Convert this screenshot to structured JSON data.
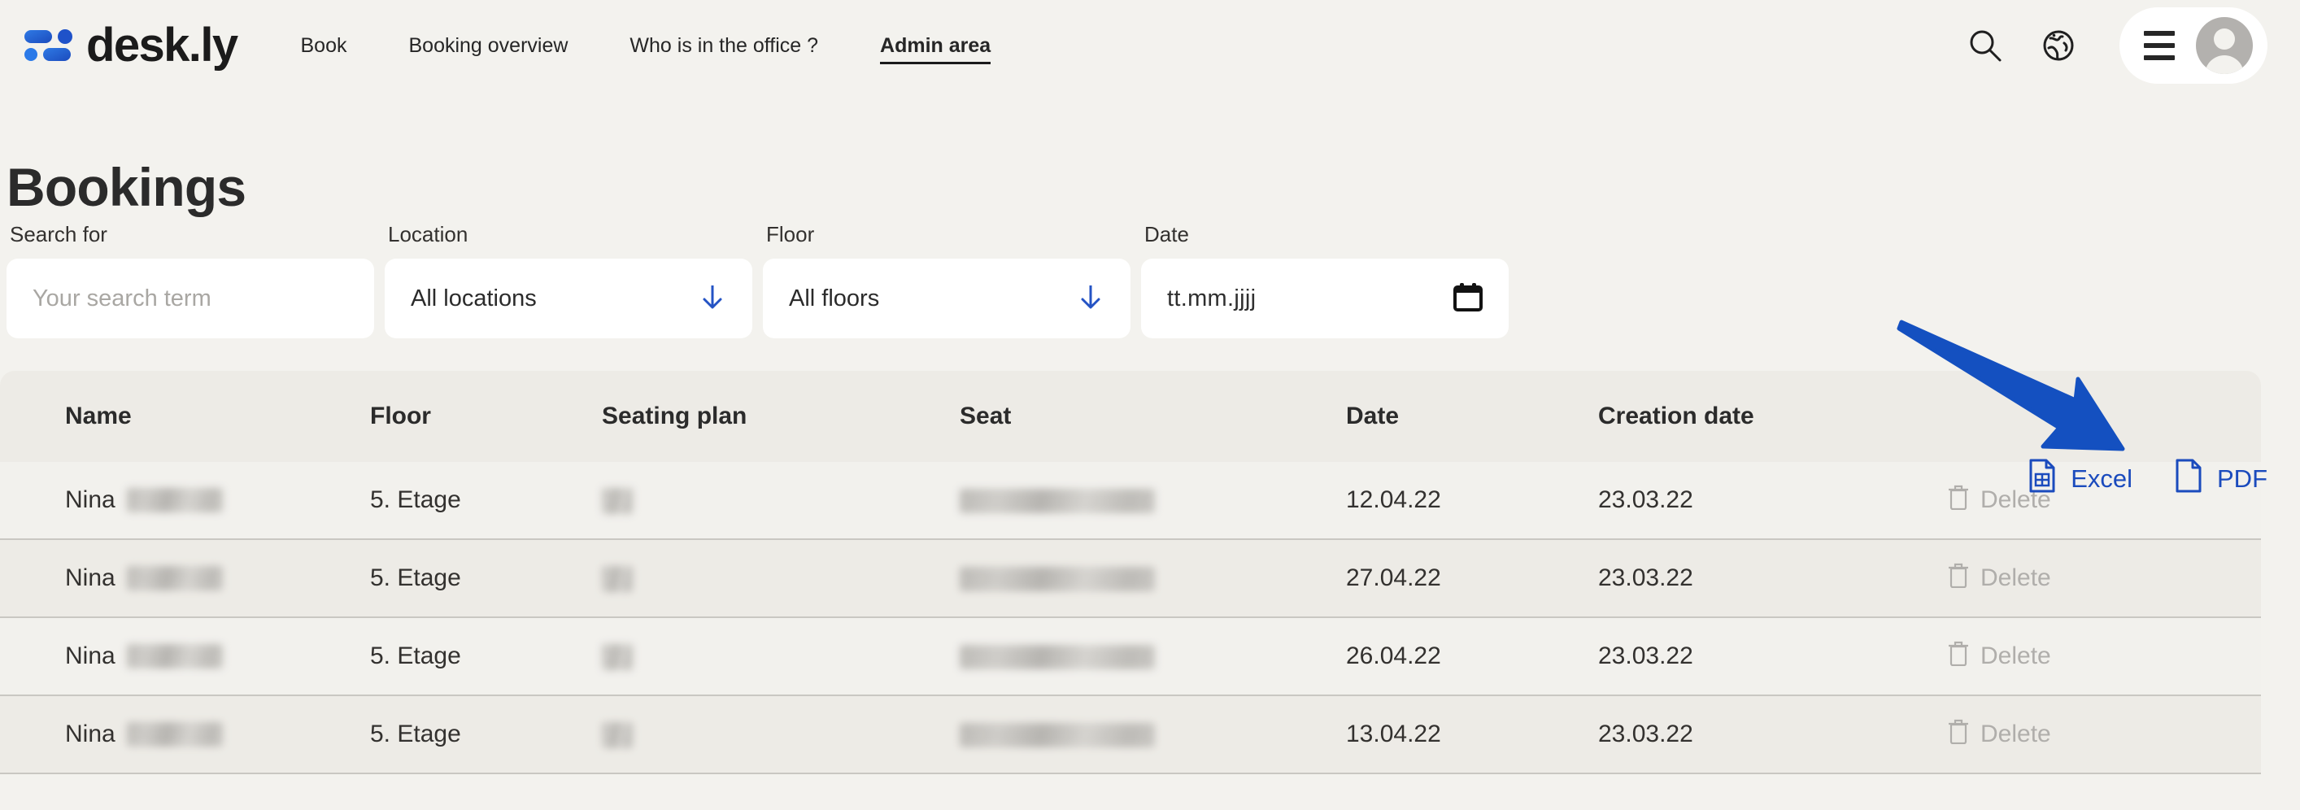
{
  "brand": {
    "name": "desk.ly",
    "logo_icon": "deskly-logo-icon"
  },
  "nav": {
    "items": [
      {
        "label": "Book",
        "active": false
      },
      {
        "label": "Booking overview",
        "active": false
      },
      {
        "label": "Who is in the office ?",
        "active": false
      },
      {
        "label": "Admin area",
        "active": true
      }
    ]
  },
  "header_icons": {
    "search": "search-icon",
    "language": "globe-icon",
    "menu": "hamburger-icon",
    "avatar": "user-avatar-icon"
  },
  "page": {
    "title": "Bookings"
  },
  "filters": {
    "search": {
      "label": "Search for",
      "placeholder": "Your search term",
      "value": ""
    },
    "location": {
      "label": "Location",
      "value": "All locations",
      "icon": "arrow-down-icon"
    },
    "floor": {
      "label": "Floor",
      "value": "All floors",
      "icon": "arrow-down-icon"
    },
    "date": {
      "label": "Date",
      "placeholder": "tt.mm.jjjj",
      "value": "",
      "icon": "calendar-icon"
    }
  },
  "exports": {
    "excel": {
      "label": "Excel",
      "icon": "excel-file-icon"
    },
    "pdf": {
      "label": "PDF",
      "icon": "pdf-file-icon"
    },
    "accent_color": "#1b4bbd"
  },
  "annotation": {
    "type": "arrow",
    "color": "#1450c0",
    "points_to": "Excel"
  },
  "table": {
    "columns": [
      "Name",
      "Floor",
      "Seating plan",
      "Seat",
      "Date",
      "Creation date",
      ""
    ],
    "rows": [
      {
        "name": "Nina",
        "name_redacted": true,
        "floor": "5. Etage",
        "seating_plan": "",
        "seating_plan_redacted": true,
        "seat": "",
        "seat_redacted": true,
        "date": "12.04.22",
        "creation_date": "23.03.22",
        "action": "Delete",
        "action_icon": "trash-icon"
      },
      {
        "name": "Nina",
        "name_redacted": true,
        "floor": "5. Etage",
        "seating_plan": "",
        "seating_plan_redacted": true,
        "seat": "",
        "seat_redacted": true,
        "date": "27.04.22",
        "creation_date": "23.03.22",
        "action": "Delete",
        "action_icon": "trash-icon"
      },
      {
        "name": "Nina",
        "name_redacted": true,
        "floor": "5. Etage",
        "seating_plan": "",
        "seating_plan_redacted": true,
        "seat": "",
        "seat_redacted": true,
        "date": "26.04.22",
        "creation_date": "23.03.22",
        "action": "Delete",
        "action_icon": "trash-icon"
      },
      {
        "name": "Nina",
        "name_redacted": true,
        "floor": "5. Etage",
        "seating_plan": "",
        "seating_plan_redacted": true,
        "seat": "",
        "seat_redacted": true,
        "date": "13.04.22",
        "creation_date": "23.03.22",
        "action": "Delete",
        "action_icon": "trash-icon"
      }
    ]
  },
  "colors": {
    "background": "#f3f2ee",
    "table_header": "#edebe6",
    "row_odd": "#f2f1ed",
    "row_even": "#edebe6",
    "brand_blue": "#1b5bd6",
    "text": "#2b2b2b"
  }
}
